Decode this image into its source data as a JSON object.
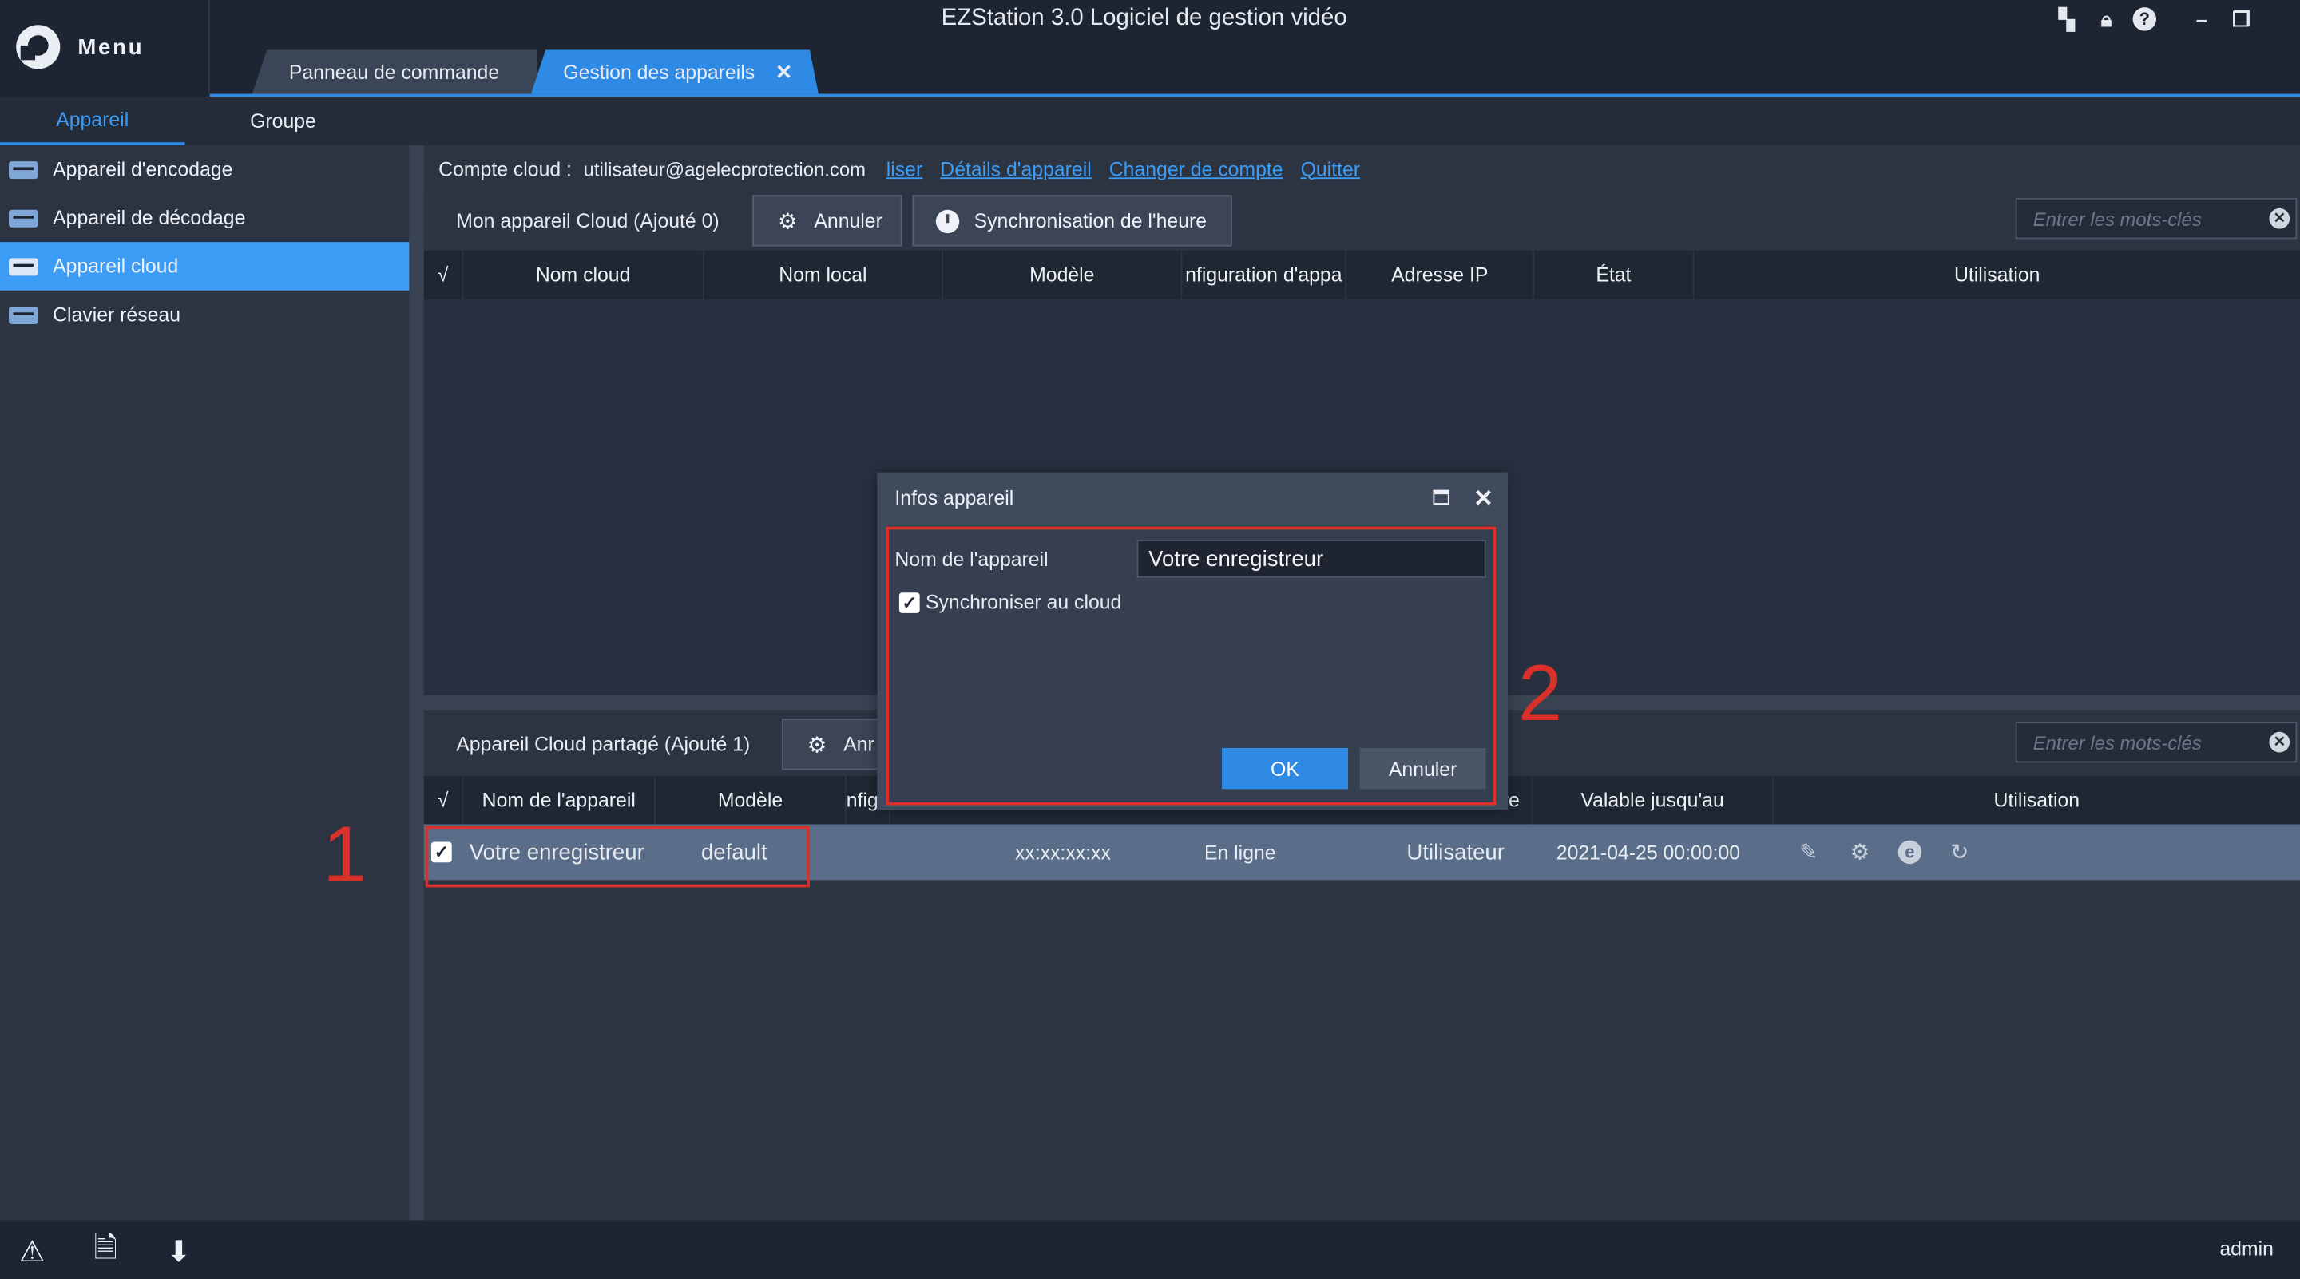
{
  "app": {
    "title": "EZStation 3.0 Logiciel de gestion vidéo",
    "menu_label": "Menu",
    "tabs": [
      {
        "label": "Panneau de commande"
      },
      {
        "label": "Gestion des appareils",
        "close": "✕"
      }
    ],
    "title_icons": [
      "layout-icon",
      "lock-icon",
      "help-icon",
      "minimize-icon",
      "restore-icon"
    ]
  },
  "subtabs": [
    {
      "label": "Appareil"
    },
    {
      "label": "Groupe"
    }
  ],
  "sidebar": {
    "items": [
      {
        "label": "Appareil d'encodage"
      },
      {
        "label": "Appareil de décodage"
      },
      {
        "label": "Appareil cloud"
      },
      {
        "label": "Clavier réseau"
      }
    ]
  },
  "cloud": {
    "account_label": "Compte cloud :",
    "email": "utilisateur@agelecprotection.com",
    "links": [
      "liser",
      "Détails d'appareil",
      "Changer de compte",
      "Quitter"
    ]
  },
  "my_cloud": {
    "label": "Mon appareil Cloud (Ajouté 0)",
    "cancel_btn": "Annuler",
    "sync_btn": "Synchronisation de l'heure",
    "search_placeholder": "Entrer les mots-clés",
    "columns": [
      "√",
      "Nom cloud",
      "Nom local",
      "Modèle",
      "nfiguration d'appa",
      "Adresse IP",
      "État",
      "Utilisation"
    ]
  },
  "shared_cloud": {
    "label": "Appareil Cloud partagé (Ajouté 1)",
    "cancel_btn": "Anr",
    "search_placeholder": "Entrer les mots-clés",
    "columns": [
      "√",
      "Nom de l'appareil",
      "Modèle",
      "nfig",
      "re",
      "Valable jusqu'au",
      "Utilisation"
    ],
    "row": {
      "checked": "✓",
      "name": "Votre enregistreur",
      "model": "default",
      "mac": "xx:xx:xx:xx",
      "status": "En ligne",
      "role": "Utilisateur",
      "valid_until": "2021-04-25 00:00:00"
    }
  },
  "dialog": {
    "title": "Infos appareil",
    "name_label": "Nom de l'appareil",
    "name_value": "Votre enregistreur",
    "sync_label": "Synchroniser au cloud",
    "sync_checked": "✓",
    "ok": "OK",
    "cancel": "Annuler"
  },
  "annotations": {
    "one": "1",
    "two": "2"
  },
  "status_bar": {
    "user": "admin"
  },
  "colors": {
    "accent": "#2f8ae6",
    "annotation": "#d9302a",
    "selected_row": "#5a6e8a"
  }
}
